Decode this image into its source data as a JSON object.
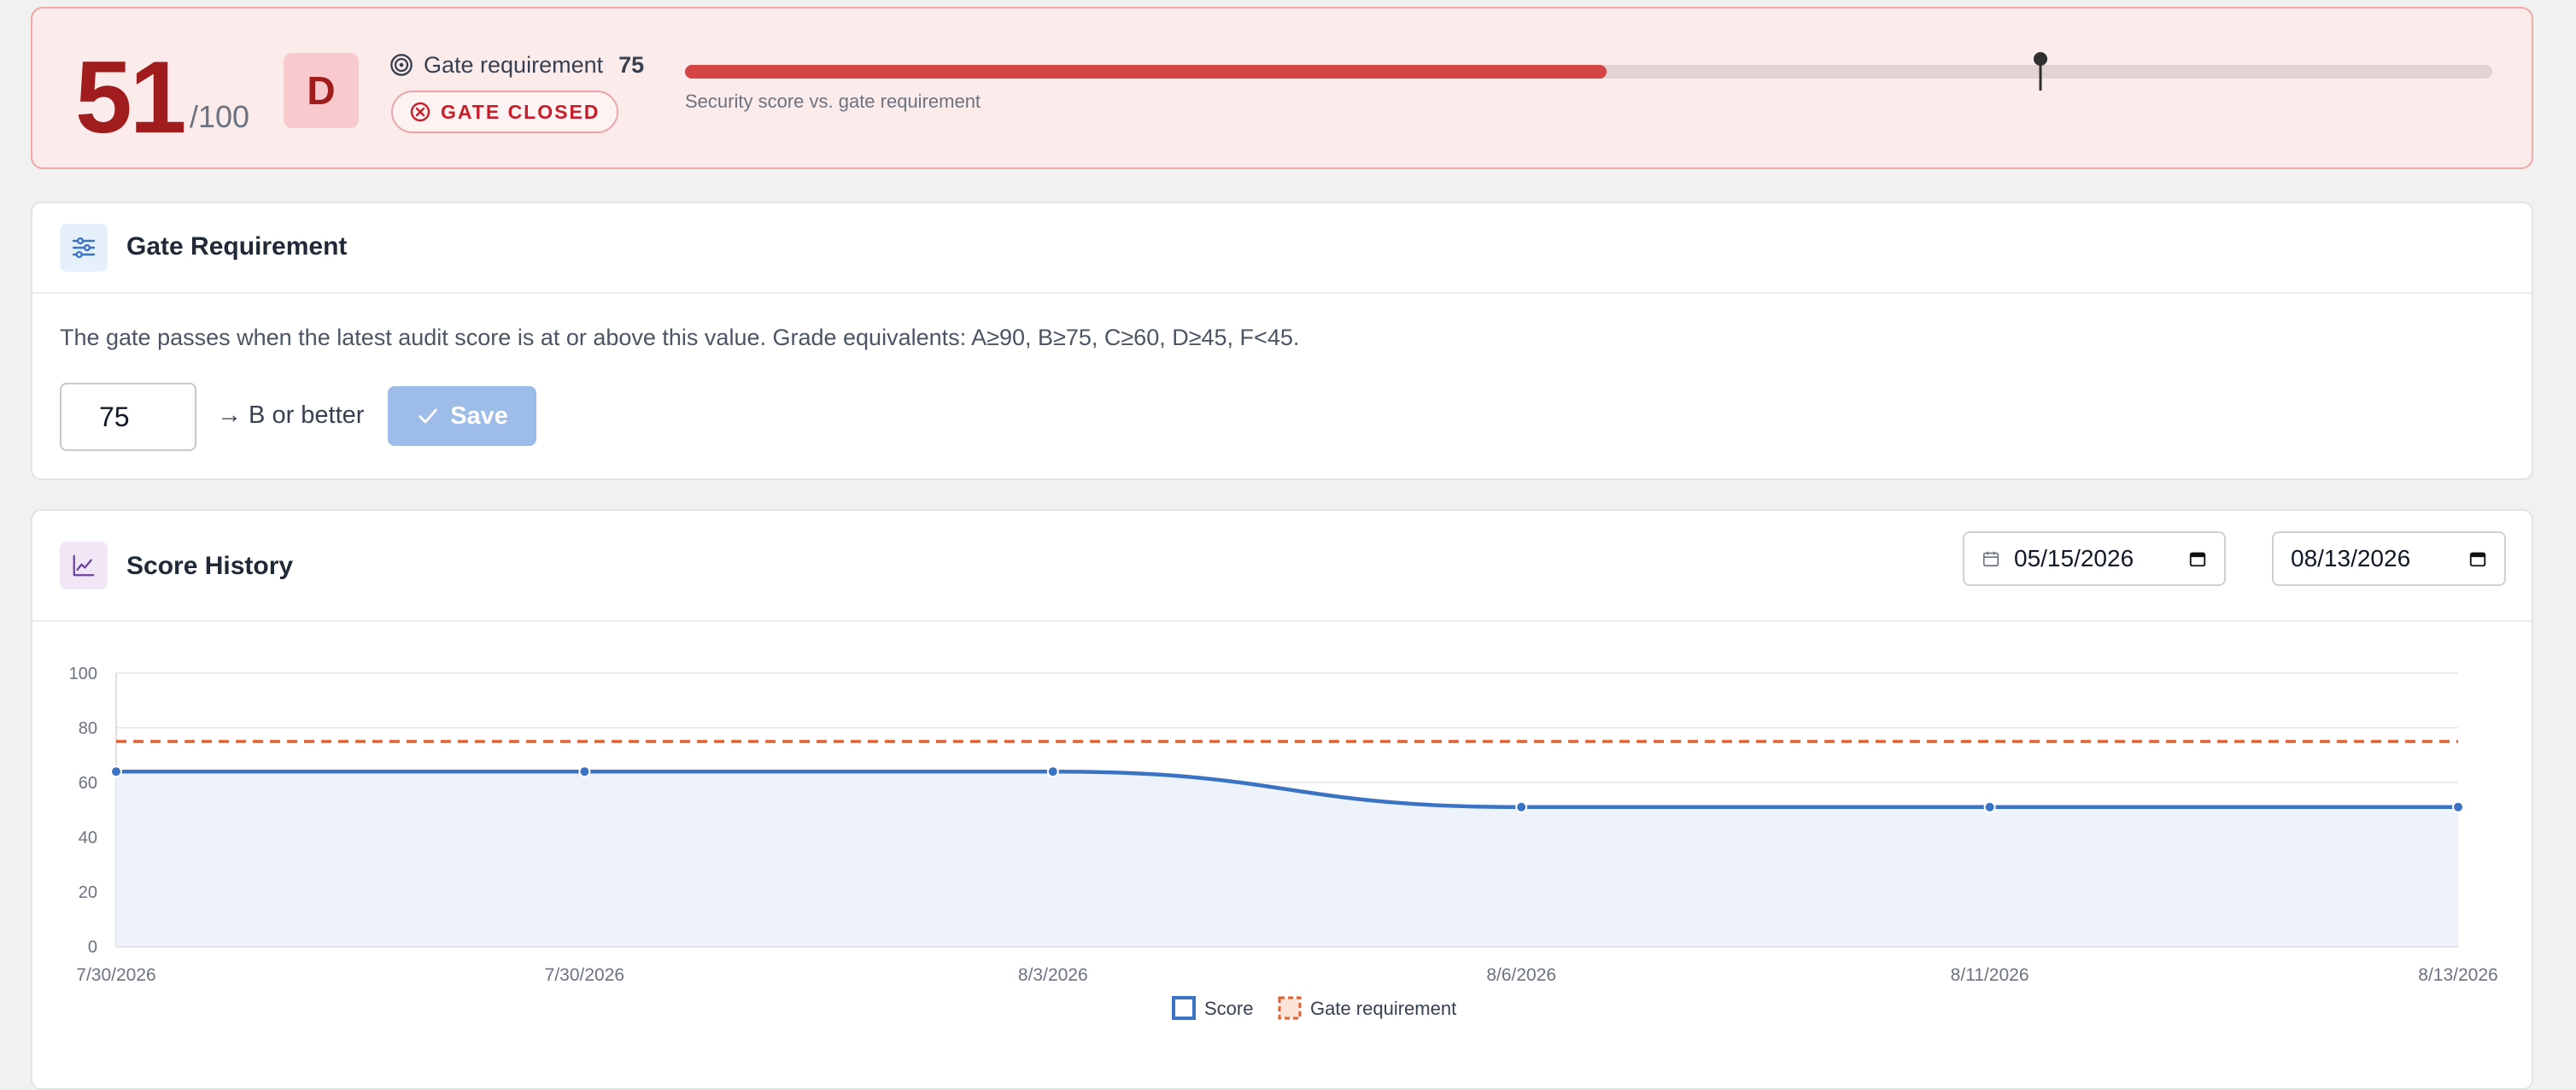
{
  "banner": {
    "score": "51",
    "score_denominator": "/100",
    "grade": "D",
    "gate_requirement_label": "Gate requirement",
    "gate_requirement_value": "75",
    "gate_status": "GATE CLOSED",
    "progress_caption": "Security score vs. gate requirement",
    "score_fraction": 0.51,
    "requirement_fraction": 0.75,
    "colors": {
      "danger": "#d64545",
      "danger_dark": "#a11c1c"
    }
  },
  "gate_card": {
    "title": "Gate Requirement",
    "icon": "sliders-icon",
    "description": "The gate passes when the latest audit score is at or above this value. Grade equivalents: A≥90, B≥75, C≥60, D≥45, F<45.",
    "input_value": "75",
    "grade_hint": "→ B or better",
    "save_label": "Save"
  },
  "history_card": {
    "title": "Score History",
    "icon": "line-chart-icon",
    "date_from": "05/15/2026",
    "date_to": "08/13/2026",
    "date_arrow": "→"
  },
  "chart_data": {
    "type": "line",
    "x": [
      "7/30/2026",
      "7/30/2026",
      "8/3/2026",
      "8/6/2026",
      "8/11/2026",
      "8/13/2026"
    ],
    "series": [
      {
        "name": "Score",
        "values": [
          64,
          64,
          64,
          51,
          51,
          51
        ],
        "color": "#3a72c4"
      },
      {
        "name": "Gate requirement",
        "values": [
          75,
          75,
          75,
          75,
          75,
          75
        ],
        "color": "#e2612e",
        "style": "dashed"
      }
    ],
    "ylim": [
      0,
      100
    ],
    "yticks": [
      "0",
      "20",
      "40",
      "60",
      "80",
      "100"
    ],
    "grid": true,
    "legend": "bottom-center"
  }
}
